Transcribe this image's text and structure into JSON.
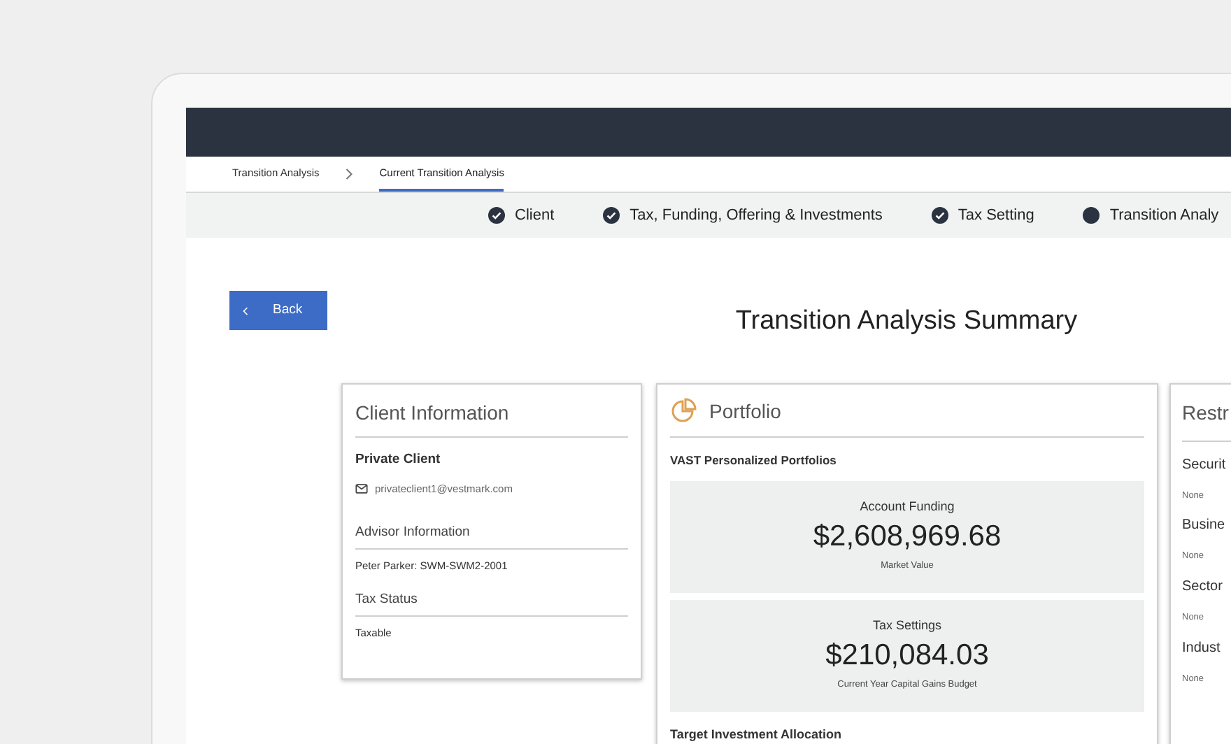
{
  "breadcrumbs": [
    {
      "label": "Transition Analysis",
      "selected": false
    },
    {
      "label": "Current Transition Analysis",
      "selected": true
    }
  ],
  "steps": [
    {
      "label": "Client",
      "completed": true
    },
    {
      "label": "Tax, Funding, Offering & Investments",
      "completed": true
    },
    {
      "label": "Tax Setting",
      "completed": true
    },
    {
      "label": "Transition Analy",
      "completed": false
    }
  ],
  "back_button": {
    "label": "Back"
  },
  "title": "Transition Analysis Summary",
  "client_card": {
    "title": "Client Information",
    "client_type": "Private Client",
    "email": "privateclient1@vestmark.com",
    "sections": [
      {
        "heading": "Advisor Information",
        "value": "Peter Parker: SWM-SWM2-2001"
      },
      {
        "heading": "Tax Status",
        "value": "Taxable"
      }
    ]
  },
  "portfolio_card": {
    "title": "Portfolio",
    "subtitle": "VAST Personalized Portfolios",
    "metrics": [
      {
        "heading": "Account Funding",
        "value": "$2,608,969.68",
        "caption": "Market Value"
      },
      {
        "heading": "Tax Settings",
        "value": "$210,084.03",
        "caption": "Current Year Capital Gains Budget"
      }
    ],
    "footer_label": "Target Investment Allocation"
  },
  "restrictions_card": {
    "title": "Restr",
    "items": [
      {
        "label": "Securit",
        "value": "None"
      },
      {
        "label": "Busine",
        "value": "None"
      },
      {
        "label": "Sector",
        "value": "None"
      },
      {
        "label": "Indust",
        "value": "None"
      }
    ]
  }
}
